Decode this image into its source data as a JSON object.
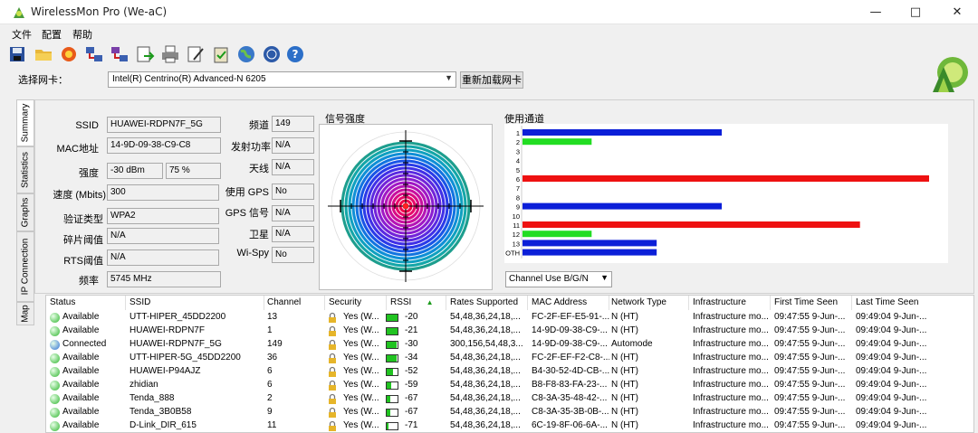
{
  "window": {
    "title": "WirelessMon Pro (We-aC)",
    "min": "—",
    "max": "□",
    "close": "✕"
  },
  "menu": [
    "文件",
    "配置",
    "帮助"
  ],
  "toolbar_icons": [
    "save-icon",
    "open-folder-icon",
    "record-icon",
    "network-icon",
    "network-multi-icon",
    "export-icon",
    "print-icon",
    "edit-icon",
    "clipboard-icon",
    "globe-icon",
    "web-icon",
    "help-icon"
  ],
  "adapter": {
    "label": "选择网卡：",
    "value": "Intel(R) Centrino(R) Advanced-N 6205",
    "reload": "重新加载网卡"
  },
  "side_tabs": [
    "Summary",
    "Statistics",
    "Graphs",
    "IP Connection",
    "Map"
  ],
  "summary": {
    "left": [
      {
        "label": "SSID",
        "values": [
          "HUAWEI-RDPN7F_5G"
        ]
      },
      {
        "label": "MAC地址",
        "values": [
          "14-9D-09-38-C9-C8"
        ]
      },
      {
        "label": "强度",
        "values": [
          "-30 dBm",
          "75 %"
        ]
      },
      {
        "label": "速度 (Mbits)",
        "values": [
          "300"
        ]
      },
      {
        "label": "验证类型",
        "values": [
          "WPA2"
        ]
      },
      {
        "label": "碎片阈值",
        "values": [
          "N/A"
        ]
      },
      {
        "label": "RTS阈值",
        "values": [
          "N/A"
        ]
      },
      {
        "label": "频率",
        "values": [
          "5745 MHz"
        ]
      }
    ],
    "right": [
      {
        "label": "频道",
        "value": "149"
      },
      {
        "label": "发射功率",
        "value": "N/A"
      },
      {
        "label": "天线",
        "value": "N/A"
      },
      {
        "label": "使用 GPS",
        "value": "No"
      },
      {
        "label": "GPS 信号",
        "value": "N/A"
      },
      {
        "label": "卫星",
        "value": "N/A"
      },
      {
        "label": "Wi-Spy",
        "value": "No"
      }
    ]
  },
  "signal": {
    "title": "信号强度",
    "strength_percent": 75
  },
  "channels": {
    "title": "使用通道",
    "labels": [
      "1",
      "2",
      "3",
      "4",
      "5",
      "6",
      "7",
      "8",
      "9",
      "10",
      "11",
      "12",
      "13",
      "OTH"
    ],
    "colors": {
      "blue": "#0b1fd8",
      "green": "#22dd22",
      "red": "#ee1111"
    },
    "bars": [
      {
        "label": "1",
        "value": 0.49,
        "color": "blue"
      },
      {
        "label": "2",
        "value": 0.17,
        "color": "green"
      },
      {
        "label": "6",
        "value": 1.0,
        "color": "red"
      },
      {
        "label": "9",
        "value": 0.49,
        "color": "blue"
      },
      {
        "label": "11",
        "value": 0.83,
        "color": "red"
      },
      {
        "label": "12",
        "value": 0.17,
        "color": "green"
      },
      {
        "label": "13",
        "value": 0.33,
        "color": "blue"
      },
      {
        "label": "OTH",
        "value": 0.33,
        "color": "blue"
      }
    ],
    "select": "Channel Use B/G/N"
  },
  "table": {
    "headers": [
      "Status",
      "SSID",
      "Channel",
      "Security",
      "RSSI",
      "Rates Supported",
      "MAC Address",
      "Network Type",
      "Infrastructure",
      "First Time Seen",
      "Last Time Seen"
    ],
    "rows": [
      {
        "status": "Available",
        "dot": "#2fb52f",
        "ssid": "UTT-HIPER_45DD2200",
        "channel": "13",
        "security": "Yes (W...",
        "rssi": "-20",
        "rssi_fill": 1.0,
        "rates": "54,48,36,24,18,...",
        "mac": "FC-2F-EF-E5-91-...",
        "type": "N (HT)",
        "infra": "Infrastructure mo...",
        "first": "09:47:55 9-Jun-...",
        "last": "09:49:04 9-Jun-..."
      },
      {
        "status": "Available",
        "dot": "#2fb52f",
        "ssid": "HUAWEI-RDPN7F",
        "channel": "1",
        "security": "Yes (W...",
        "rssi": "-21",
        "rssi_fill": 1.0,
        "rates": "54,48,36,24,18,...",
        "mac": "14-9D-09-38-C9-...",
        "type": "N (HT)",
        "infra": "Infrastructure mo...",
        "first": "09:47:55 9-Jun-...",
        "last": "09:49:04 9-Jun-..."
      },
      {
        "status": "Connected",
        "dot": "#2d6fd6",
        "ssid": "HUAWEI-RDPN7F_5G",
        "channel": "149",
        "security": "Yes (W...",
        "rssi": "-30",
        "rssi_fill": 0.95,
        "rates": "300,156,54,48,3...",
        "mac": "14-9D-09-38-C9-...",
        "type": "Automode",
        "infra": "Infrastructure mo...",
        "first": "09:47:55 9-Jun-...",
        "last": "09:49:04 9-Jun-..."
      },
      {
        "status": "Available",
        "dot": "#2fb52f",
        "ssid": "UTT-HIPER-5G_45DD2200",
        "channel": "36",
        "security": "Yes (W...",
        "rssi": "-34",
        "rssi_fill": 0.9,
        "rates": "54,48,36,24,18,...",
        "mac": "FC-2F-EF-F2-C8-...",
        "type": "N (HT)",
        "infra": "Infrastructure mo...",
        "first": "09:47:55 9-Jun-...",
        "last": "09:49:04 9-Jun-..."
      },
      {
        "status": "Available",
        "dot": "#2fb52f",
        "ssid": "HUAWEI-P94AJZ",
        "channel": "6",
        "security": "Yes (W...",
        "rssi": "-52",
        "rssi_fill": 0.6,
        "rates": "54,48,36,24,18,...",
        "mac": "B4-30-52-4D-CB-...",
        "type": "N (HT)",
        "infra": "Infrastructure mo...",
        "first": "09:47:55 9-Jun-...",
        "last": "09:49:04 9-Jun-..."
      },
      {
        "status": "Available",
        "dot": "#2fb52f",
        "ssid": "zhidian",
        "channel": "6",
        "security": "Yes (W...",
        "rssi": "-59",
        "rssi_fill": 0.45,
        "rates": "54,48,36,24,18,...",
        "mac": "B8-F8-83-FA-23-...",
        "type": "N (HT)",
        "infra": "Infrastructure mo...",
        "first": "09:47:55 9-Jun-...",
        "last": "09:49:04 9-Jun-..."
      },
      {
        "status": "Available",
        "dot": "#2fb52f",
        "ssid": "Tenda_888",
        "channel": "2",
        "security": "Yes (W...",
        "rssi": "-67",
        "rssi_fill": 0.3,
        "rates": "54,48,36,24,18,...",
        "mac": "C8-3A-35-48-42-...",
        "type": "N (HT)",
        "infra": "Infrastructure mo...",
        "first": "09:47:55 9-Jun-...",
        "last": "09:49:04 9-Jun-..."
      },
      {
        "status": "Available",
        "dot": "#2fb52f",
        "ssid": "Tenda_3B0B58",
        "channel": "9",
        "security": "Yes (W...",
        "rssi": "-67",
        "rssi_fill": 0.3,
        "rates": "54,48,36,24,18,...",
        "mac": "C8-3A-35-3B-0B-...",
        "type": "N (HT)",
        "infra": "Infrastructure mo...",
        "first": "09:47:55 9-Jun-...",
        "last": "09:49:04 9-Jun-..."
      },
      {
        "status": "Available",
        "dot": "#2fb52f",
        "ssid": "D-Link_DIR_615",
        "channel": "11",
        "security": "Yes (W...",
        "rssi": "-71",
        "rssi_fill": 0.2,
        "rates": "54,48,36,24,18,...",
        "mac": "6C-19-8F-06-6A-...",
        "type": "N (HT)",
        "infra": "Infrastructure mo...",
        "first": "09:47:55 9-Jun-...",
        "last": "09:49:04 9-Jun-..."
      }
    ]
  }
}
